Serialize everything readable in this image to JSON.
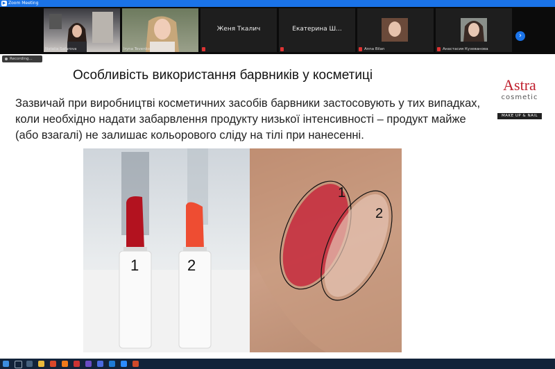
{
  "window": {
    "title": "Zoom Meeting"
  },
  "participants": [
    {
      "name": "Natalia Safarova",
      "video": true
    },
    {
      "name": "Iryna Tevenko",
      "video": true
    },
    {
      "name": "Женя Ткалич",
      "video": false
    },
    {
      "name": "Екатерина Ш...",
      "video": false
    },
    {
      "name": "Anna Bilan",
      "video": true
    },
    {
      "name": "Анастасия Кузеванова",
      "video": true
    }
  ],
  "recording": {
    "label": "Recording..."
  },
  "slide": {
    "title": "Особливість використання барвників у косметиці",
    "body": "Зазвичай при виробництві косметичних засобів барвники застосовують у тих випадках, коли необхідно надати забарвлення продукту низької інтенсивності – продукт майже (або взагалі) не залишає кольорового сліду на тілі при нанесенні.",
    "logo": {
      "brand": "Astra",
      "sub": "cosmetic",
      "tagline": "MAKE UP & NAIL"
    },
    "photo_labels": {
      "lipstick_1": "1",
      "lipstick_2": "2",
      "swatch_1": "1",
      "swatch_2": "2"
    }
  },
  "colors": {
    "zoom_blue": "#1a73e8",
    "brand_red": "#c0202e",
    "taskbar": "#12233a"
  }
}
